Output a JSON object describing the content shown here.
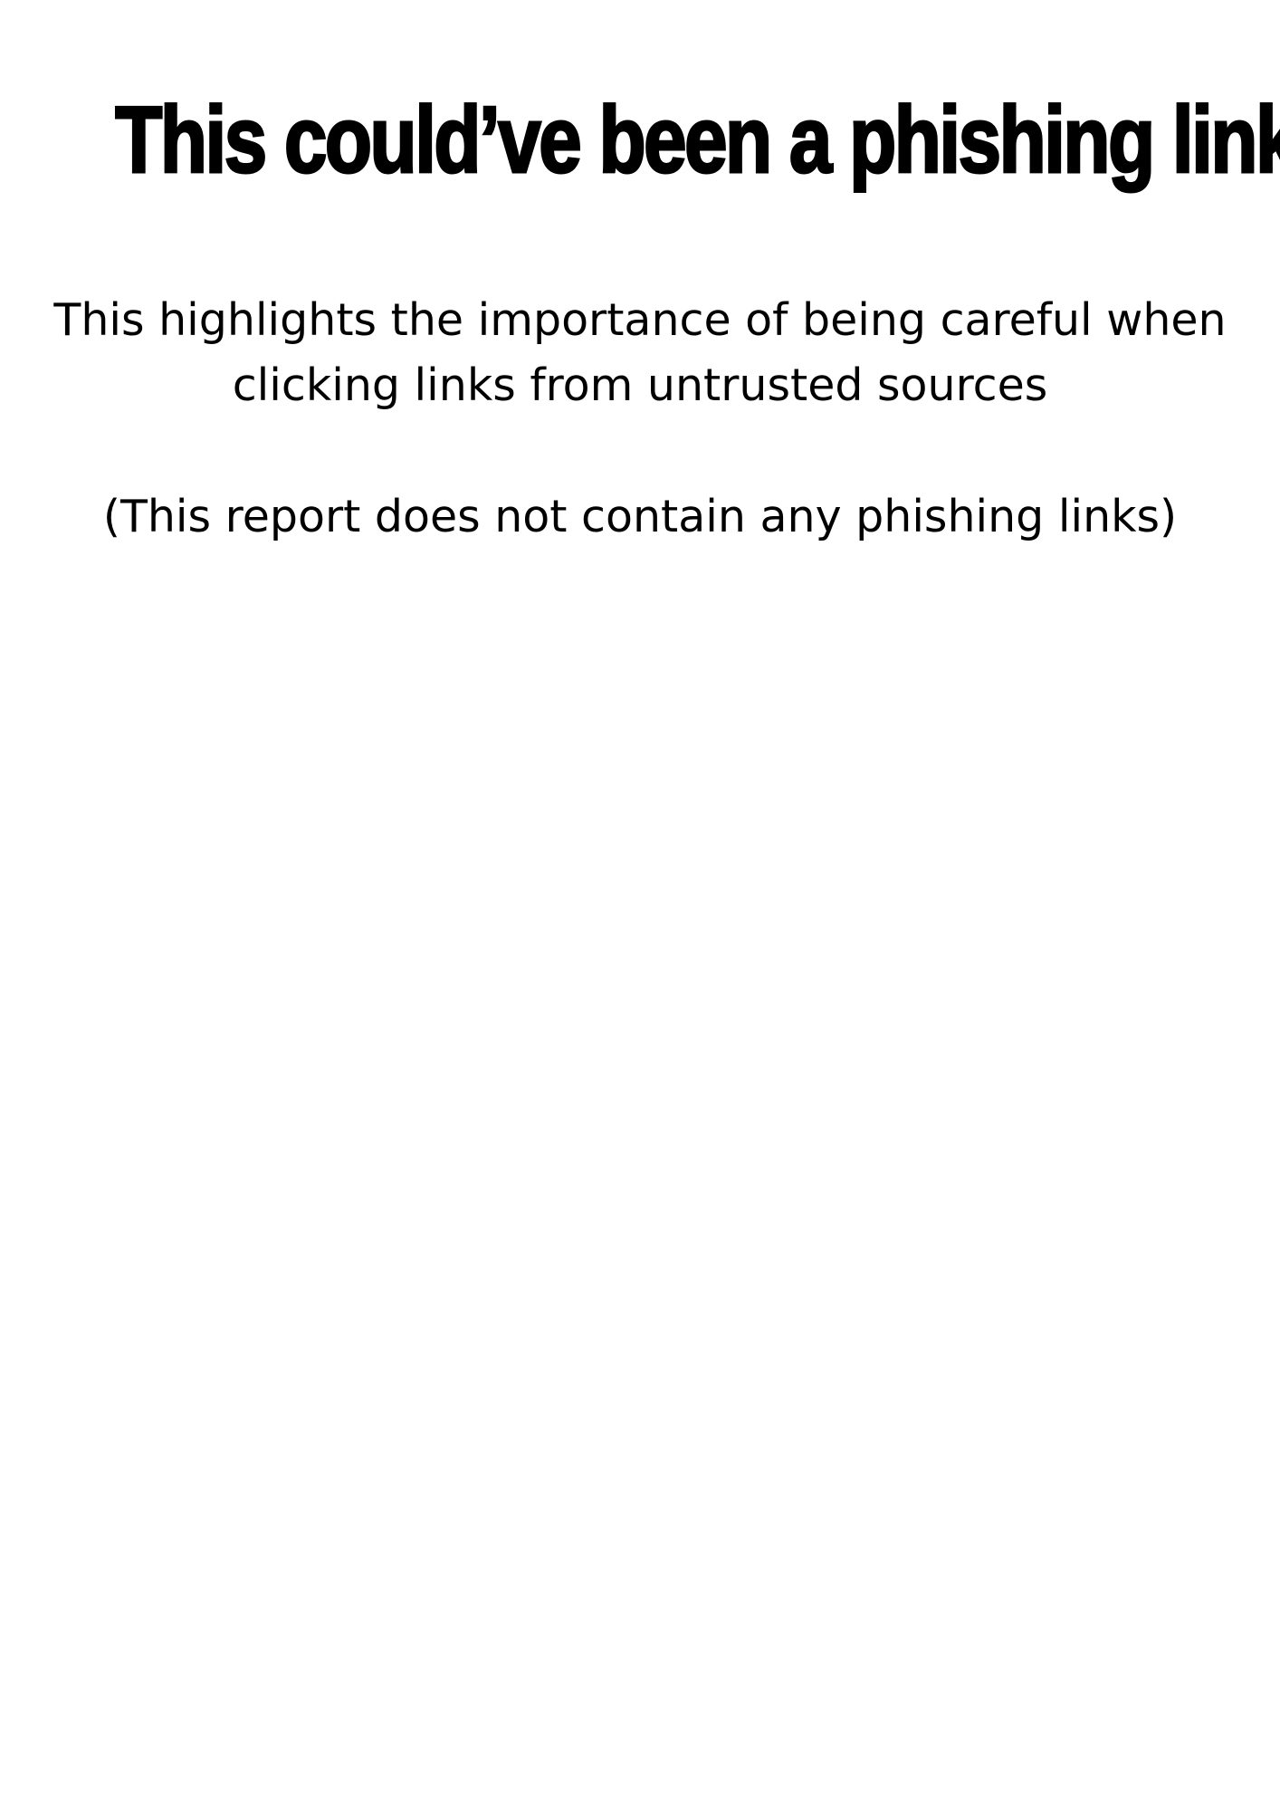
{
  "document": {
    "headline": "This could’ve been a phishing link",
    "message_line_1": "This highlights the importance of being careful when",
    "message_line_2": "clicking links from untrusted sources",
    "disclaimer": "(This report does not contain any phishing links)"
  },
  "colors": {
    "background": "#ffffff",
    "text": "#000000"
  }
}
